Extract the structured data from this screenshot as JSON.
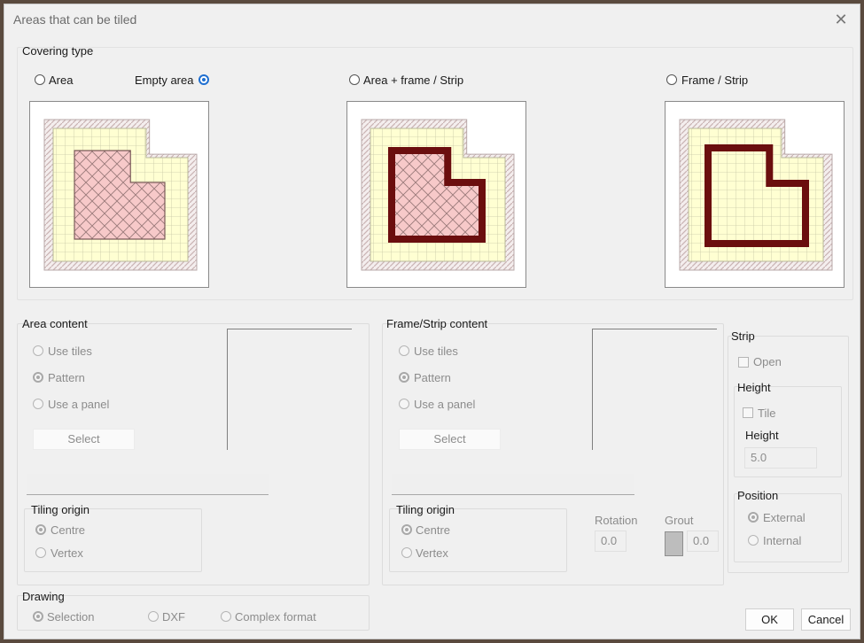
{
  "title": "Areas that can be tiled",
  "covering": {
    "label": "Covering type",
    "options": [
      "Area",
      "Empty area",
      "Area + frame / Strip",
      "Frame / Strip"
    ],
    "selected": "Empty area"
  },
  "area_content": {
    "label": "Area content",
    "options": [
      "Use tiles",
      "Pattern",
      "Use a panel"
    ],
    "selected": "Pattern",
    "select_label": "Select",
    "tiling_origin": {
      "label": "Tiling origin",
      "options": [
        "Centre",
        "Vertex"
      ],
      "selected": "Centre"
    }
  },
  "frame_content": {
    "label": "Frame/Strip content",
    "options": [
      "Use tiles",
      "Pattern",
      "Use a panel"
    ],
    "selected": "Pattern",
    "select_label": "Select",
    "tiling_origin": {
      "label": "Tiling origin",
      "options": [
        "Centre",
        "Vertex"
      ],
      "selected": "Centre"
    },
    "rotation_label": "Rotation",
    "rotation_value": "0.0",
    "grout_label": "Grout",
    "grout_value": "0.0"
  },
  "strip": {
    "label": "Strip",
    "open_label": "Open",
    "height_group_label": "Height",
    "tile_label": "Tile",
    "height_label": "Height",
    "height_value": "5.0",
    "position_label": "Position",
    "position_options": [
      "External",
      "Internal"
    ],
    "position_selected": "External"
  },
  "drawing": {
    "label": "Drawing",
    "options": [
      "Selection",
      "DXF",
      "Complex format"
    ],
    "selected": "Selection"
  },
  "buttons": {
    "ok": "OK",
    "cancel": "Cancel"
  },
  "colors": {
    "accent": "#1f6fd1",
    "tile_fill": "#ffffd2",
    "area_fill": "#f7c9c9",
    "frame": "#6b0e0e",
    "hatch": "#c9b3b3"
  }
}
